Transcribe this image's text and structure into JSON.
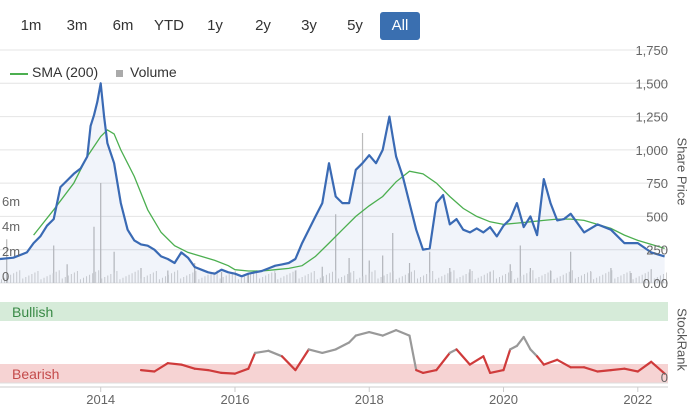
{
  "range_buttons": [
    {
      "label": "1m",
      "active": false
    },
    {
      "label": "3m",
      "active": false
    },
    {
      "label": "6m",
      "active": false
    },
    {
      "label": "YTD",
      "active": false
    },
    {
      "label": "1y",
      "active": false
    },
    {
      "label": "2y",
      "active": false
    },
    {
      "label": "3y",
      "active": false
    },
    {
      "label": "5y",
      "active": false
    },
    {
      "label": "All",
      "active": true
    }
  ],
  "legend": {
    "sma_label": "SMA (200)",
    "volume_label": "Volume"
  },
  "colors": {
    "price": "#3a6ab4",
    "sma": "#4caf50",
    "volume": "#bbbbbb",
    "bullish": "#d6ebd9",
    "bearish": "#f6d3d3",
    "rank_bear": "#cf3b3b",
    "rank_neutral": "#999999"
  },
  "chart_data": [
    {
      "type": "line",
      "title": "",
      "ylabel": "Share Price",
      "xlim": [
        2012.5,
        2022.45
      ],
      "ylim": [
        0,
        1750
      ],
      "price_ticks": [
        "0.00",
        "250",
        "500",
        "750",
        "1,000",
        "1,250",
        "1,500",
        "1,750"
      ],
      "price_tick_values": [
        0,
        250,
        500,
        750,
        1000,
        1250,
        1500,
        1750
      ],
      "volume_ticks": [
        "0",
        "2m",
        "4m",
        "6m"
      ],
      "volume_tick_values": [
        0,
        2000000,
        4000000,
        6000000
      ],
      "volume_max": 12000000,
      "x_ticks": [
        "2014",
        "2016",
        "2018",
        "2020",
        "2022"
      ],
      "x_tick_values": [
        2014,
        2016,
        2018,
        2020,
        2022
      ],
      "series": [
        {
          "name": "",
          "x": [
            2012.5,
            2012.7,
            2012.9,
            2013.0,
            2013.1,
            2013.2,
            2013.3,
            2013.4,
            2013.5,
            2013.6,
            2013.7,
            2013.8,
            2013.85,
            2013.9,
            2013.95,
            2014.0,
            2014.05,
            2014.1,
            2014.2,
            2014.3,
            2014.4,
            2014.5,
            2014.6,
            2014.7,
            2014.8,
            2014.9,
            2015.0,
            2015.1,
            2015.2,
            2015.3,
            2015.4,
            2015.5,
            2015.6,
            2015.7,
            2015.8,
            2015.9,
            2016.0,
            2016.1,
            2016.2,
            2016.3,
            2016.4,
            2016.5,
            2016.6,
            2016.7,
            2016.8,
            2016.9,
            2017.0,
            2017.1,
            2017.2,
            2017.3,
            2017.4,
            2017.5,
            2017.6,
            2017.7,
            2017.8,
            2017.9,
            2018.0,
            2018.1,
            2018.2,
            2018.3,
            2018.35,
            2018.4,
            2018.5,
            2018.6,
            2018.7,
            2018.8,
            2018.9,
            2019.0,
            2019.1,
            2019.2,
            2019.3,
            2019.4,
            2019.5,
            2019.6,
            2019.7,
            2019.8,
            2019.9,
            2020.0,
            2020.1,
            2020.2,
            2020.3,
            2020.4,
            2020.5,
            2020.6,
            2020.7,
            2020.8,
            2020.9,
            2021.0,
            2021.2,
            2021.4,
            2021.6,
            2021.8,
            2022.0,
            2022.2,
            2022.4
          ],
          "y": [
            180,
            190,
            230,
            300,
            350,
            430,
            480,
            720,
            770,
            820,
            860,
            950,
            1180,
            1260,
            1360,
            1500,
            1250,
            1050,
            900,
            600,
            400,
            320,
            290,
            280,
            250,
            200,
            180,
            150,
            230,
            190,
            120,
            100,
            80,
            70,
            100,
            80,
            70,
            50,
            70,
            80,
            90,
            110,
            130,
            140,
            150,
            180,
            300,
            400,
            500,
            600,
            900,
            650,
            600,
            600,
            850,
            900,
            960,
            900,
            1000,
            1250,
            1100,
            950,
            800,
            600,
            400,
            250,
            260,
            600,
            660,
            440,
            480,
            400,
            380,
            410,
            380,
            420,
            350,
            430,
            480,
            600,
            420,
            500,
            360,
            780,
            600,
            470,
            480,
            520,
            380,
            440,
            400,
            300,
            300,
            230,
            200
          ]
        },
        {
          "name": "",
          "x": [
            2013.0,
            2013.3,
            2013.6,
            2013.8,
            2014.0,
            2014.1,
            2014.2,
            2014.3,
            2014.5,
            2014.7,
            2014.9,
            2015.1,
            2015.3,
            2015.5,
            2015.7,
            2015.9,
            2016.0,
            2016.2,
            2016.4,
            2016.6,
            2016.8,
            2017.0,
            2017.2,
            2017.4,
            2017.6,
            2017.8,
            2018.0,
            2018.2,
            2018.4,
            2018.6,
            2018.8,
            2019.0,
            2019.2,
            2019.4,
            2019.6,
            2019.8,
            2020.0,
            2020.2,
            2020.4,
            2020.6,
            2020.8,
            2021.0,
            2021.2,
            2021.4,
            2021.6,
            2021.8,
            2022.0,
            2022.2,
            2022.4
          ],
          "y": [
            360,
            550,
            750,
            950,
            1100,
            1150,
            1120,
            1000,
            800,
            550,
            380,
            280,
            230,
            200,
            170,
            130,
            100,
            90,
            90,
            100,
            110,
            130,
            200,
            300,
            400,
            500,
            580,
            650,
            760,
            840,
            820,
            750,
            650,
            560,
            500,
            460,
            440,
            450,
            460,
            470,
            480,
            480,
            470,
            440,
            410,
            360,
            320,
            290,
            260
          ]
        }
      ],
      "volume": [
        [
          2012.6,
          3500000
        ],
        [
          2013.3,
          3000000
        ],
        [
          2013.5,
          1500000
        ],
        [
          2013.9,
          4500000
        ],
        [
          2014.0,
          8000000
        ],
        [
          2014.2,
          2500000
        ],
        [
          2014.6,
          1200000
        ],
        [
          2015.0,
          1000000
        ],
        [
          2015.4,
          1600000
        ],
        [
          2015.8,
          900000
        ],
        [
          2016.2,
          700000
        ],
        [
          2016.6,
          800000
        ],
        [
          2016.9,
          1000000
        ],
        [
          2017.3,
          1300000
        ],
        [
          2017.5,
          5500000
        ],
        [
          2017.7,
          2000000
        ],
        [
          2017.9,
          12000000
        ],
        [
          2018.0,
          1800000
        ],
        [
          2018.2,
          2200000
        ],
        [
          2018.35,
          4000000
        ],
        [
          2018.6,
          1600000
        ],
        [
          2018.9,
          2500000
        ],
        [
          2019.2,
          1200000
        ],
        [
          2019.5,
          1100000
        ],
        [
          2019.8,
          900000
        ],
        [
          2020.1,
          1500000
        ],
        [
          2020.25,
          3000000
        ],
        [
          2020.4,
          1200000
        ],
        [
          2020.7,
          1000000
        ],
        [
          2021.0,
          2500000
        ],
        [
          2021.3,
          900000
        ],
        [
          2021.6,
          1200000
        ],
        [
          2021.9,
          800000
        ],
        [
          2022.2,
          1100000
        ]
      ]
    },
    {
      "type": "line",
      "ylabel": "StockRank",
      "bands": {
        "top_label": "Bullish",
        "bottom_label": "Bearish"
      },
      "ylim": [
        0,
        100
      ],
      "y_ticks": [
        "0"
      ],
      "y_tick_values": [
        0
      ],
      "series": [
        {
          "name": "",
          "x": [
            2014.6,
            2014.8,
            2015.0,
            2015.2,
            2015.4,
            2015.6,
            2015.8,
            2016.0,
            2016.2,
            2016.3,
            2016.5,
            2016.7,
            2016.9,
            2017.1,
            2017.3,
            2017.5,
            2017.7,
            2017.8,
            2018.0,
            2018.2,
            2018.4,
            2018.6,
            2018.7,
            2018.8,
            2019.0,
            2019.2,
            2019.3,
            2019.5,
            2019.7,
            2019.8,
            2020.0,
            2020.1,
            2020.2,
            2020.3,
            2020.4,
            2020.5,
            2020.6,
            2020.8,
            2021.0,
            2021.2,
            2021.4,
            2021.6,
            2021.8,
            2022.0,
            2022.2,
            2022.4
          ],
          "y": [
            10,
            8,
            20,
            18,
            12,
            10,
            6,
            5,
            12,
            35,
            38,
            30,
            10,
            40,
            35,
            40,
            50,
            60,
            65,
            60,
            68,
            60,
            10,
            6,
            10,
            35,
            40,
            18,
            30,
            6,
            10,
            40,
            45,
            58,
            40,
            30,
            18,
            25,
            14,
            14,
            8,
            10,
            12,
            8,
            22,
            5
          ],
          "bullish_threshold": 33
        }
      ]
    }
  ]
}
